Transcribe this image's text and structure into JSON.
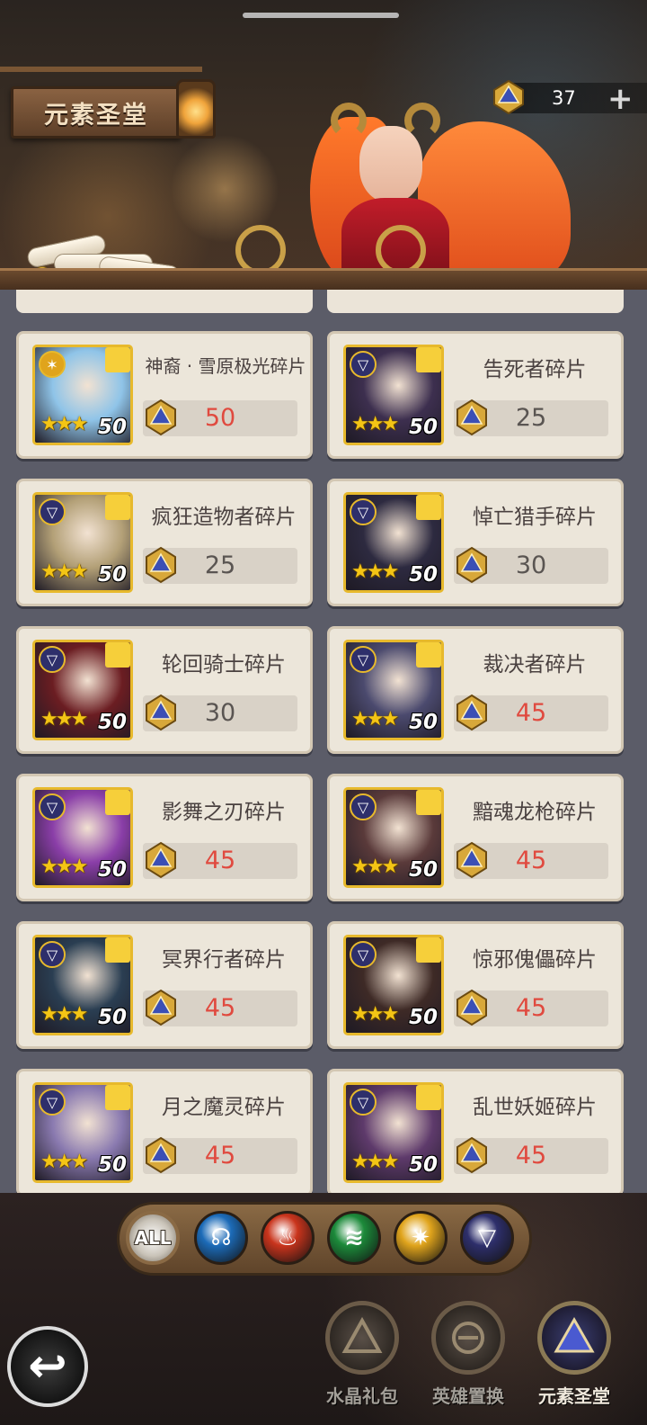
{
  "header": {
    "title": "元素圣堂",
    "currency_amount": "37",
    "currency_plus": "+",
    "currency_icon": "crystal-icon"
  },
  "shop": {
    "items": [
      {
        "name": "神裔 · 雪原极光碎片",
        "price": "50",
        "level": "50",
        "stars": 3,
        "element": "light",
        "price_color": "#e04a3f",
        "portrait_color": "#8fc4e8"
      },
      {
        "name": "告死者碎片",
        "price": "25",
        "level": "50",
        "stars": 3,
        "element": "void",
        "price_color": "#5a5552",
        "portrait_color": "#3d2f4f"
      },
      {
        "name": "疯狂造物者碎片",
        "price": "25",
        "level": "50",
        "stars": 3,
        "element": "void",
        "price_color": "#5a5552",
        "portrait_color": "#b3a077"
      },
      {
        "name": "悼亡猎手碎片",
        "price": "30",
        "level": "50",
        "stars": 3,
        "element": "void",
        "price_color": "#5a5552",
        "portrait_color": "#2d2a40"
      },
      {
        "name": "轮回骑士碎片",
        "price": "30",
        "level": "50",
        "stars": 3,
        "element": "void",
        "price_color": "#5a5552",
        "portrait_color": "#6b1d22"
      },
      {
        "name": "裁决者碎片",
        "price": "45",
        "level": "50",
        "stars": 3,
        "element": "void",
        "price_color": "#e04a3f",
        "portrait_color": "#4b4a6e"
      },
      {
        "name": "影舞之刃碎片",
        "price": "45",
        "level": "50",
        "stars": 3,
        "element": "void",
        "price_color": "#e04a3f",
        "portrait_color": "#8a3ea8"
      },
      {
        "name": "黯魂龙枪碎片",
        "price": "45",
        "level": "50",
        "stars": 3,
        "element": "void",
        "price_color": "#e04a3f",
        "portrait_color": "#5a3a3a"
      },
      {
        "name": "冥界行者碎片",
        "price": "45",
        "level": "50",
        "stars": 3,
        "element": "void",
        "price_color": "#e04a3f",
        "portrait_color": "#2a3e52"
      },
      {
        "name": "惊邪傀儡碎片",
        "price": "45",
        "level": "50",
        "stars": 3,
        "element": "void",
        "price_color": "#e04a3f",
        "portrait_color": "#3e2a26"
      },
      {
        "name": "月之魔灵碎片",
        "price": "45",
        "level": "50",
        "stars": 3,
        "element": "void",
        "price_color": "#e04a3f",
        "portrait_color": "#8a7ab0"
      },
      {
        "name": "乱世妖姬碎片",
        "price": "45",
        "level": "50",
        "stars": 3,
        "element": "void",
        "price_color": "#e04a3f",
        "portrait_color": "#5e3a6b"
      }
    ]
  },
  "filters": {
    "all_label": "ALL",
    "buttons": [
      {
        "name": "filter-all",
        "color": "#d8d2c6"
      },
      {
        "name": "filter-water-icon",
        "color": "#1c6bb8"
      },
      {
        "name": "filter-fire-icon",
        "color": "#c9341c"
      },
      {
        "name": "filter-nature-icon",
        "color": "#1c8a3a"
      },
      {
        "name": "filter-light-icon",
        "color": "#e0a41c"
      },
      {
        "name": "filter-void-icon",
        "color": "#2e2f6b"
      }
    ]
  },
  "nav": {
    "back_icon": "back-arrow-icon",
    "items": [
      {
        "label": "水晶礼包",
        "active": false
      },
      {
        "label": "英雄置换",
        "active": false
      },
      {
        "label": "元素圣堂",
        "active": true
      }
    ]
  }
}
